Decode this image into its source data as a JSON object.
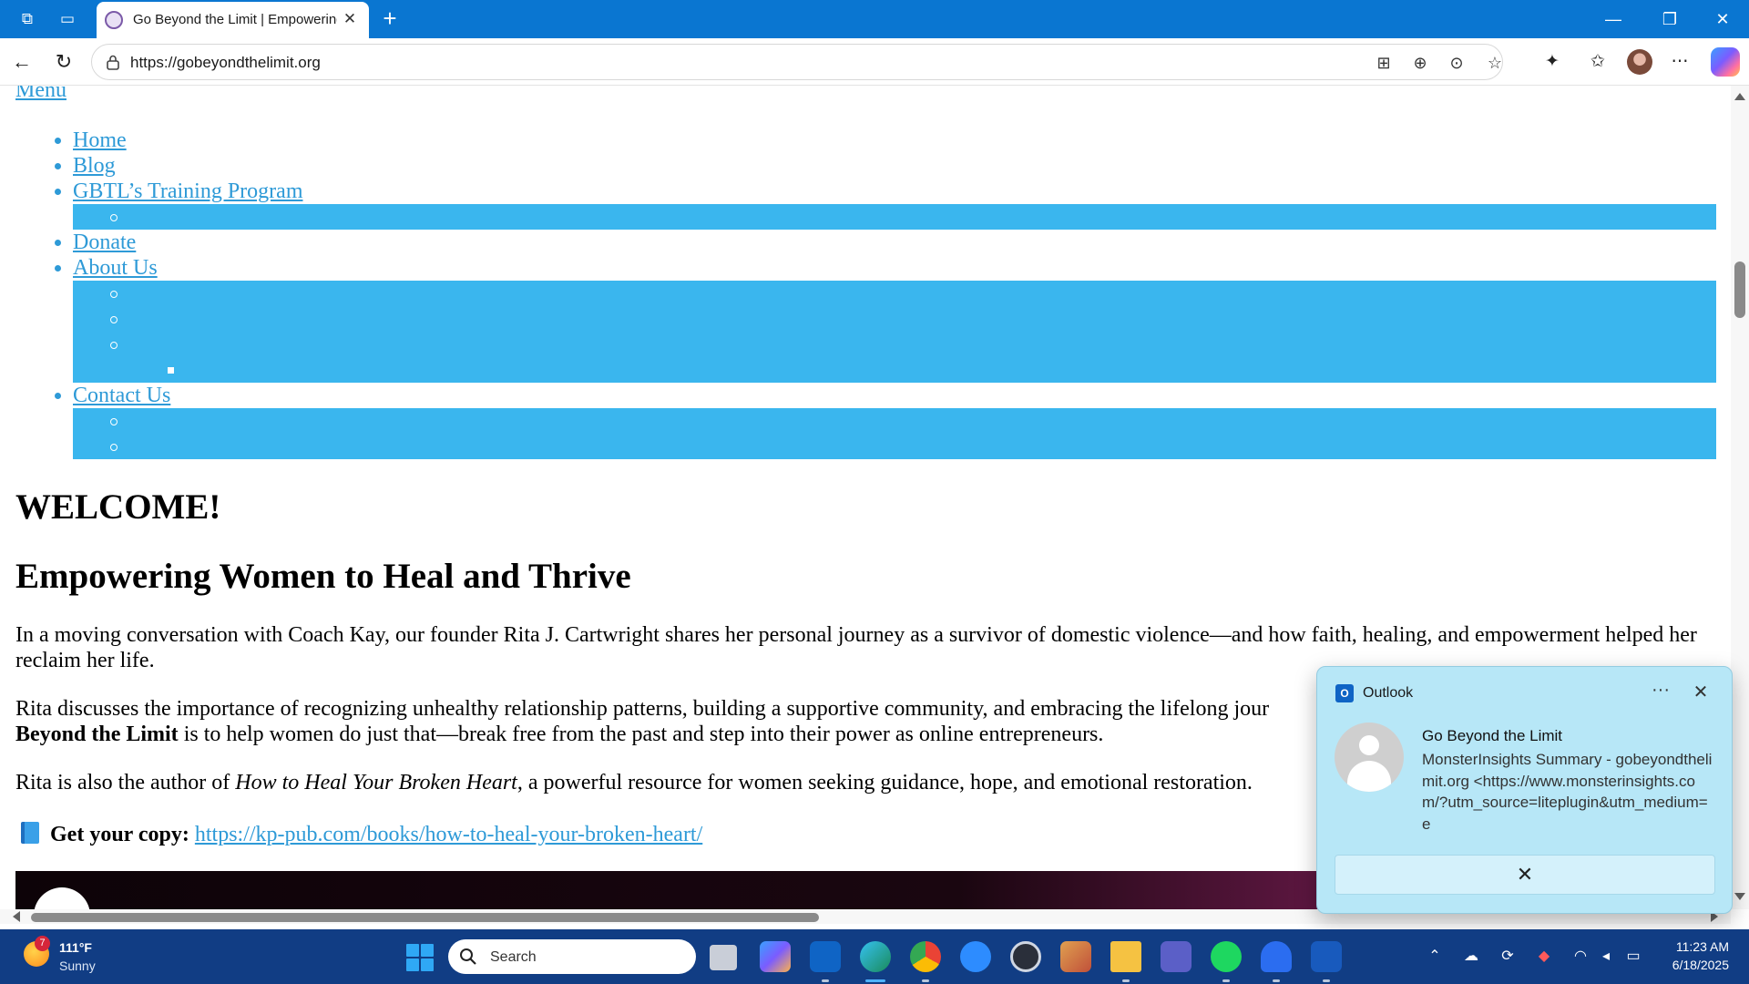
{
  "browser": {
    "tab_title": "Go Beyond the Limit | Empowering Women to Heal and Thrive",
    "url": "https://gobeyondthelimit.org"
  },
  "site": {
    "menu_label": "Menu",
    "nav": [
      {
        "label": "Home",
        "submenu_count": 0
      },
      {
        "label": "Blog",
        "submenu_count": 0
      },
      {
        "label": "GBTL’s Training Program",
        "submenu_count": 1
      },
      {
        "label": "Donate",
        "submenu_count": 0
      },
      {
        "label": "About Us",
        "submenu_count": 4
      },
      {
        "label": "Contact Us",
        "submenu_count": 2
      }
    ],
    "submenu_color": "#3ab6ee",
    "link_color": "#2e9ad7",
    "heading_welcome": "WELCOME!",
    "heading_empower": "Empowering Women to Heal and Thrive",
    "para1": "In a moving conversation with Coach Kay, our founder Rita J. Cartwright shares her personal journey as a survivor of domestic violence—and how faith, healing, and empowerment helped her reclaim her life.",
    "para2_start": "Rita discusses the importance of recognizing unhealthy relationship patterns, building a supportive community, and embracing the lifelong jour",
    "para2_bold": "Beyond the Limit",
    "para2_end": " is to help women do just that—break free from the past and step into their power as online entrepreneurs.",
    "para3_start": "Rita is also the author of ",
    "para3_book": "How to Heal Your Broken Heart",
    "para3_end": ", a powerful resource for women seeking guidance, hope, and emotional restoration.",
    "get_copy_label": "Get your copy:",
    "book_link": "https://kp-pub.com/books/how-to-heal-your-broken-heart/"
  },
  "notification": {
    "app": "Outlook",
    "sender": "Go Beyond the Limit",
    "body": "MonsterInsights Summary - gobeyondthelimit.org <https://www.monsterinsights.com/?utm_source=liteplugin&utm_medium=e",
    "more_glyph": "···",
    "close_glyph": "✕",
    "dismiss_glyph": "✕"
  },
  "taskbar": {
    "weather_badge": "7",
    "weather_temp": "111°F",
    "weather_condition": "Sunny",
    "search_placeholder": "Search",
    "time": "11:23 AM",
    "date": "6/18/2025"
  }
}
